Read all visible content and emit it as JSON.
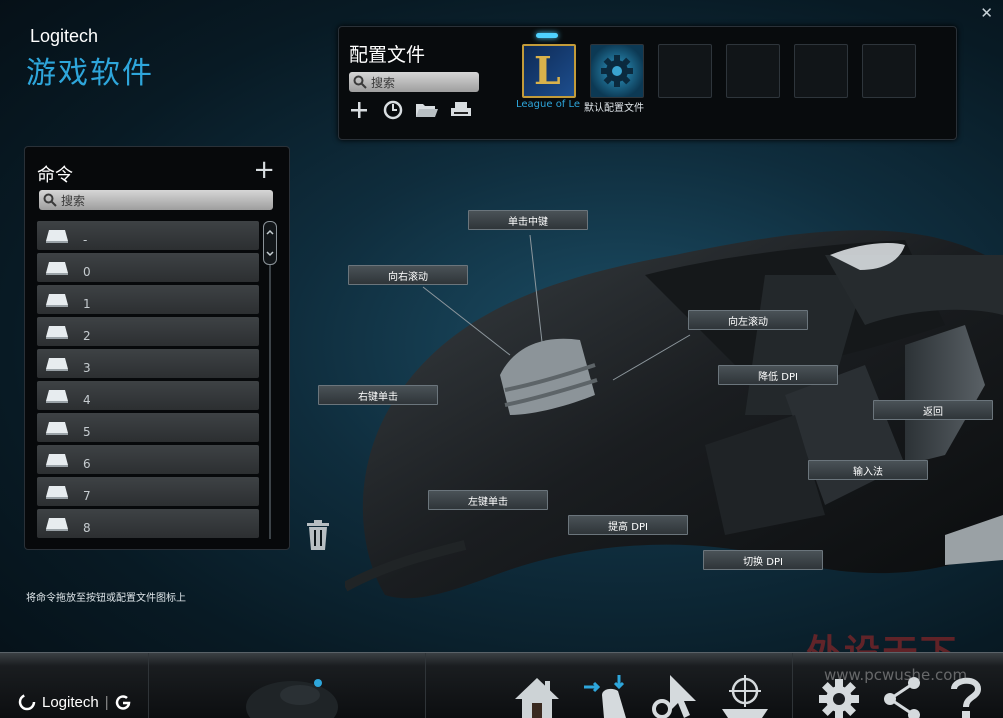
{
  "brand": {
    "name": "Logitech",
    "app_title": "游戏软件"
  },
  "window": {
    "close_glyph": "✕"
  },
  "profiles": {
    "title": "配置文件",
    "search_placeholder": "搜索",
    "slots": [
      {
        "label": "League of Legends",
        "display_label": "League of Le",
        "icon": "league-of-legends-icon",
        "active": true
      },
      {
        "label": "默认配置文件",
        "icon": "gear-icon",
        "active": false
      }
    ],
    "tools": [
      "add-icon",
      "history-icon",
      "folder-icon",
      "printer-icon"
    ]
  },
  "commands": {
    "title": "命令",
    "add_glyph": "+",
    "search_placeholder": "搜索",
    "items": [
      "-",
      "0",
      "1",
      "2",
      "3",
      "4",
      "5",
      "6",
      "7",
      "8"
    ]
  },
  "mouse_callouts": {
    "middle_click": "单击中键",
    "scroll_right": "向右滚动",
    "scroll_left": "向左滚动",
    "right_click": "右键单击",
    "dpi_down": "降低 DPI",
    "back": "返回",
    "ime": "输入法",
    "left_click": "左键单击",
    "dpi_up": "提高 DPI",
    "dpi_cycle": "切换 DPI"
  },
  "hint": "将命令拖放至按钮或配置文件图标上",
  "bottom": {
    "brand": "Logitech",
    "nav_icons": [
      "home-icon",
      "customize-buttons-icon",
      "pointer-settings-icon",
      "surface-tuning-icon",
      "settings-icon",
      "share-icon",
      "help-icon"
    ]
  },
  "watermark": {
    "text": "外设天下",
    "url": "www.pcwushe.com"
  },
  "colors": {
    "accent": "#2ea6db",
    "lol_gold": "#c29b3a",
    "panel_bg": "#07090b"
  }
}
